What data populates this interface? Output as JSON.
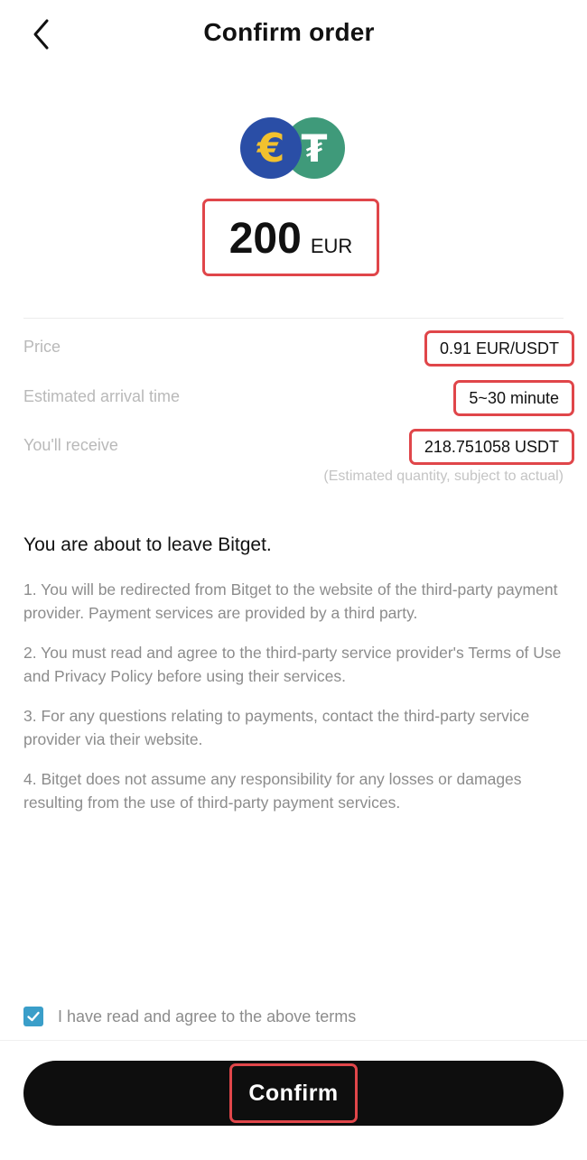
{
  "header": {
    "title": "Confirm order"
  },
  "coins": {
    "fiat_symbol": "€",
    "crypto_symbol": "₮"
  },
  "amount": {
    "value": "200",
    "unit": "EUR"
  },
  "details": {
    "price_label": "Price",
    "price_value": "0.91 EUR/USDT",
    "arrival_label": "Estimated arrival time",
    "arrival_value": "5~30 minute",
    "receive_label": "You'll receive",
    "receive_value": "218.751058 USDT",
    "receive_note": "(Estimated quantity, subject to actual)"
  },
  "notice": {
    "title": "You are about to leave Bitget.",
    "items": [
      "1. You will be redirected from Bitget to the website of the third-party payment provider. Payment services are provided by a third party.",
      "2. You must read and agree to the third-party service provider's Terms of Use and Privacy Policy before using their services.",
      "3. For any questions relating to payments, contact the third-party service provider via their website.",
      "4. Bitget does not assume any responsibility for any losses or damages resulting from the use of third-party payment services."
    ]
  },
  "agreement": {
    "checked": true,
    "label": "I have read and agree to the above terms"
  },
  "actions": {
    "confirm_label": "Confirm"
  },
  "colors": {
    "highlight": "#e0464a",
    "checkbox": "#3a9ec9",
    "button_bg": "#0e0e0e",
    "eur_coin": "#2a4ea6",
    "usdt_coin": "#3f9a7a"
  }
}
